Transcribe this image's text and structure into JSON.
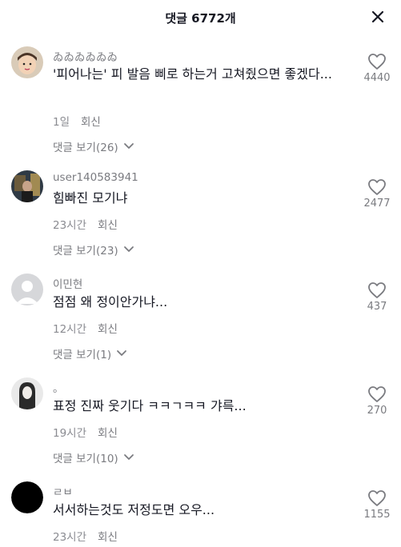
{
  "header": {
    "title": "댓글 6772개",
    "close_icon": "close-icon"
  },
  "comments": [
    {
      "username": "ゐゐゐゐゐゐ",
      "text": "'피어나는' 피 발음 삐로 하는거 고쳐줬으면 좋겠다...",
      "time": "1일",
      "reply_label": "회신",
      "view_replies": "댓글 보기(26)",
      "likes": "4440"
    },
    {
      "username": "user140583941",
      "text": "힘빠진 모기냐",
      "time": "23시간",
      "reply_label": "회신",
      "view_replies": "댓글 보기(23)",
      "likes": "2477"
    },
    {
      "username": "이민현",
      "text": "점점 왜 정이안가냐...",
      "time": "12시간",
      "reply_label": "회신",
      "view_replies": "댓글 보기(1)",
      "likes": "437"
    },
    {
      "username": "。",
      "text": "표정 진짜 웃기다 ㅋㅋㄱㅋㅋ 갸륵...",
      "time": "19시간",
      "reply_label": "회신",
      "view_replies": "댓글 보기(10)",
      "likes": "270"
    },
    {
      "username": "ㄹㅂ",
      "text": "서서하는것도 저정도면 오우...",
      "time": "23시간",
      "reply_label": "회신",
      "likes": "1155"
    }
  ]
}
